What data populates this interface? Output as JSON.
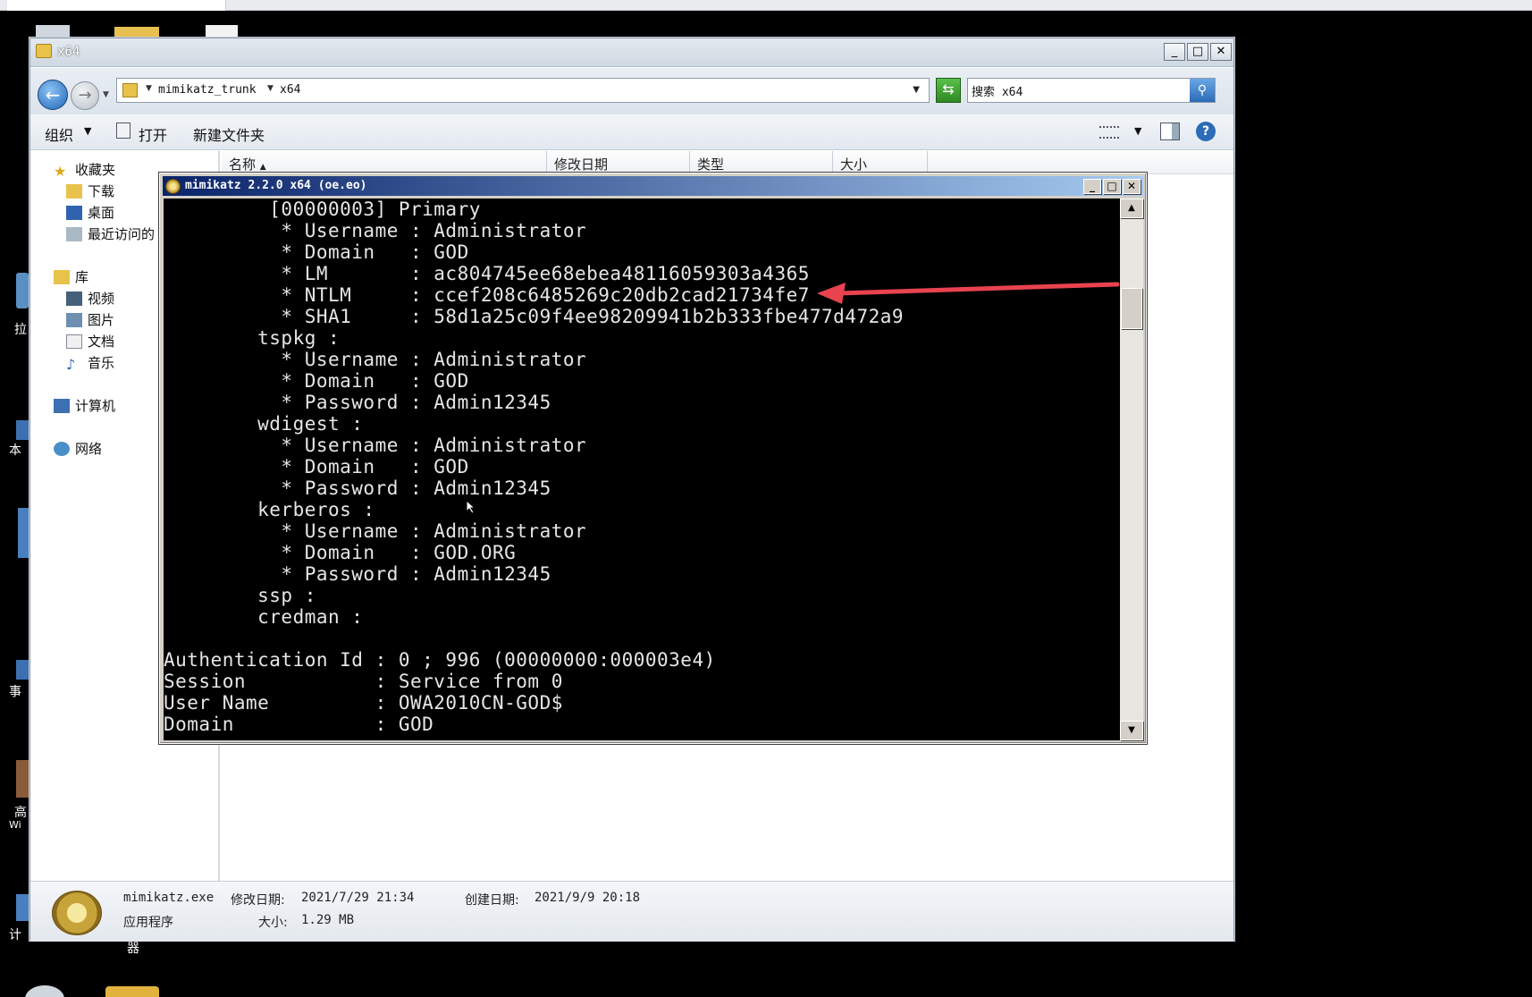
{
  "explorer": {
    "title": "x64",
    "controls": {
      "min": "_",
      "max": "□",
      "close": "✕"
    },
    "breadcrumb": [
      "mimikatz_trunk",
      "x64"
    ],
    "search": {
      "value": "搜索 x64"
    },
    "toolbar": {
      "organize": "组织",
      "open": "打开",
      "new_folder": "新建文件夹"
    },
    "nav": {
      "favorites": "收藏夹",
      "fav_items": [
        "下载",
        "桌面",
        "最近访问的"
      ],
      "library": "库",
      "lib_items": [
        "视频",
        "图片",
        "文档",
        "音乐"
      ],
      "computer": "计算机",
      "network": "网络"
    },
    "columns": [
      "名称",
      "修改日期",
      "类型",
      "大小"
    ],
    "details": {
      "filename": "mimikatz.exe",
      "modified_label": "修改日期:",
      "modified": "2021/7/29 21:34",
      "created_label": "创建日期:",
      "created": "2021/9/9 20:18",
      "type": "应用程序",
      "size_label": "大小:",
      "size": "1.29 MB"
    }
  },
  "console": {
    "title": "mimikatz 2.2.0 x64 (oe.eo)",
    "controls": {
      "min": "_",
      "max": "□",
      "close": "✕"
    },
    "lines": [
      "         [00000003] Primary",
      "          * Username : Administrator",
      "          * Domain   : GOD",
      "          * LM       : ac804745ee68ebea48116059303a4365",
      "          * NTLM     : ccef208c6485269c20db2cad21734fe7",
      "          * SHA1     : 58d1a25c09f4ee98209941b2b333fbe477d472a9",
      "        tspkg :",
      "          * Username : Administrator",
      "          * Domain   : GOD",
      "          * Password : Admin12345",
      "        wdigest :",
      "          * Username : Administrator",
      "          * Domain   : GOD",
      "          * Password : Admin12345",
      "        kerberos :",
      "          * Username : Administrator",
      "          * Domain   : GOD.ORG",
      "          * Password : Admin12345",
      "        ssp :",
      "        credman :",
      "",
      "Authentication Id : 0 ; 996 (00000000:000003e4)",
      "Session           : Service from 0",
      "User Name         : OWA2010CN-GOD$",
      "Domain            : GOD"
    ]
  },
  "desktop": {
    "labels": [
      "拉",
      "本",
      "事",
      "高",
      "Wi",
      "计",
      "器"
    ]
  },
  "colors": {
    "annotation_arrow": "#e8434f",
    "console_bg": "#000000",
    "title_blue": "#0a246a"
  }
}
